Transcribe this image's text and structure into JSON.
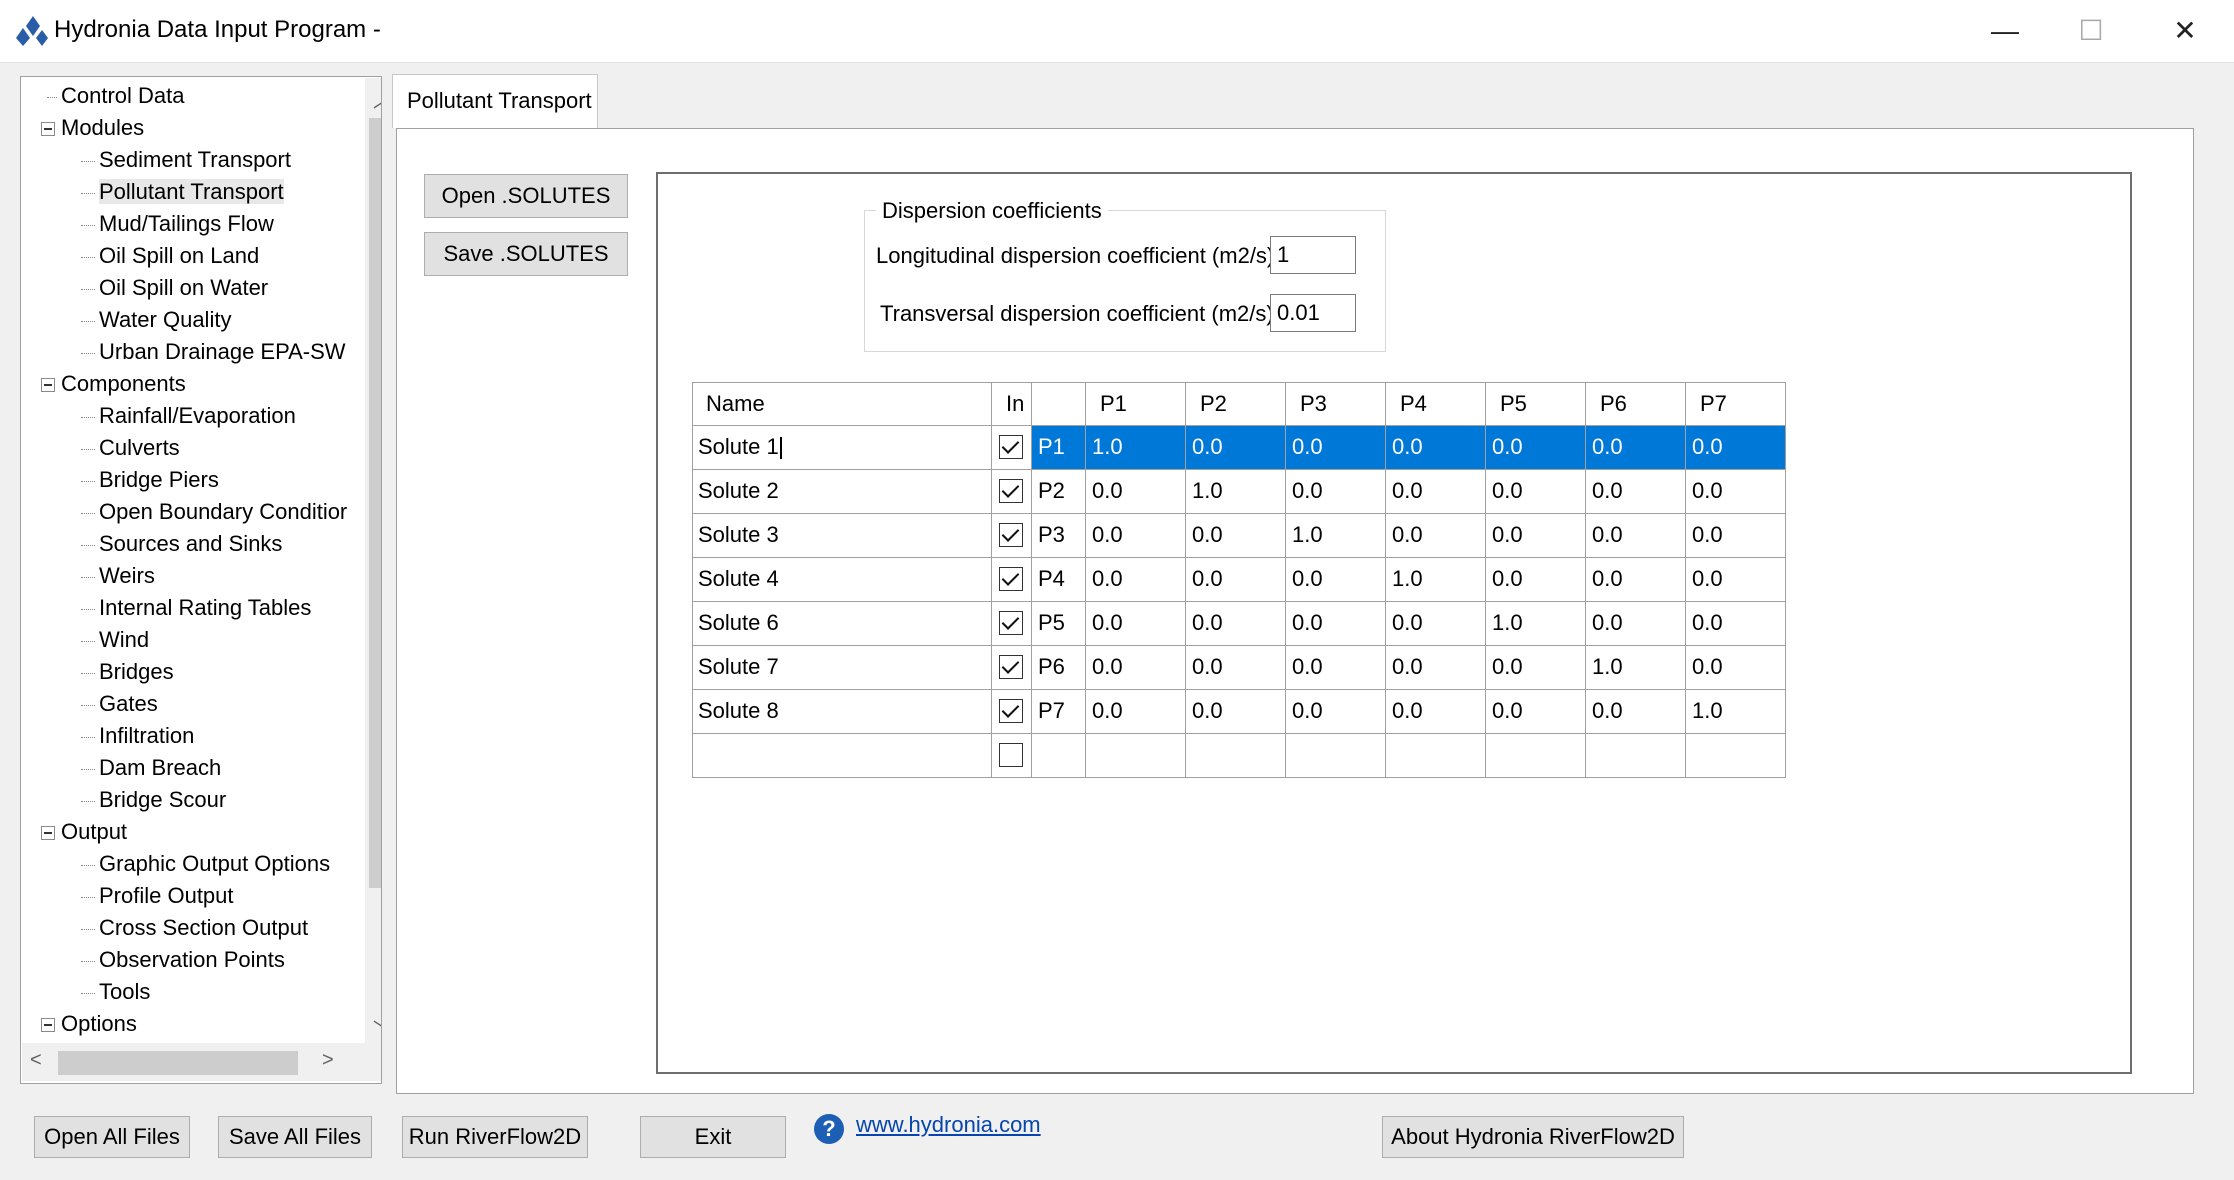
{
  "window": {
    "title": "Hydronia Data Input Program -",
    "minimize": "—",
    "maximize": "☐",
    "close": "✕"
  },
  "tree": {
    "items": [
      {
        "label": "Control Data",
        "level": 0
      },
      {
        "label": "Modules",
        "level": 0,
        "expander": true
      },
      {
        "label": "Sediment Transport",
        "level": 1
      },
      {
        "label": "Pollutant Transport",
        "level": 1,
        "selected": true
      },
      {
        "label": "Mud/Tailings Flow",
        "level": 1
      },
      {
        "label": "Oil Spill on Land",
        "level": 1
      },
      {
        "label": "Oil Spill on Water",
        "level": 1
      },
      {
        "label": "Water Quality",
        "level": 1
      },
      {
        "label": "Urban Drainage EPA-SW",
        "level": 1
      },
      {
        "label": "Components",
        "level": 0,
        "expander": true
      },
      {
        "label": "Rainfall/Evaporation",
        "level": 1
      },
      {
        "label": "Culverts",
        "level": 1
      },
      {
        "label": "Bridge Piers",
        "level": 1
      },
      {
        "label": "Open Boundary Conditior",
        "level": 1
      },
      {
        "label": "Sources and Sinks",
        "level": 1
      },
      {
        "label": "Weirs",
        "level": 1
      },
      {
        "label": "Internal Rating Tables",
        "level": 1
      },
      {
        "label": "Wind",
        "level": 1
      },
      {
        "label": "Bridges",
        "level": 1
      },
      {
        "label": "Gates",
        "level": 1
      },
      {
        "label": "Infiltration",
        "level": 1
      },
      {
        "label": "Dam Breach",
        "level": 1
      },
      {
        "label": "Bridge Scour",
        "level": 1
      },
      {
        "label": "Output",
        "level": 0,
        "expander": true
      },
      {
        "label": "Graphic Output Options",
        "level": 1
      },
      {
        "label": "Profile Output",
        "level": 1
      },
      {
        "label": "Cross Section Output",
        "level": 1
      },
      {
        "label": "Observation Points",
        "level": 1
      },
      {
        "label": "Tools",
        "level": 1
      },
      {
        "label": "Options",
        "level": 0,
        "expander": true
      }
    ]
  },
  "tab": {
    "label": "Pollutant Transport"
  },
  "buttons": {
    "open_solutes": "Open .SOLUTES",
    "save_solutes": "Save .SOLUTES"
  },
  "dispersion": {
    "group_title": "Dispersion coefficients",
    "longitudinal_label": "Longitudinal dispersion coefficient (m2/s)",
    "longitudinal_value": "1",
    "transversal_label": "Transversal dispersion coefficient (m2/s):",
    "transversal_value": "0.01"
  },
  "grid": {
    "headers": [
      "Name",
      "In",
      "",
      "P1",
      "P2",
      "P3",
      "P4",
      "P5",
      "P6",
      "P7"
    ],
    "rows": [
      {
        "name": "Solute 1",
        "in": true,
        "param": "P1",
        "values": [
          "1.0",
          "0.0",
          "0.0",
          "0.0",
          "0.0",
          "0.0",
          "0.0"
        ],
        "selected": true
      },
      {
        "name": "Solute 2",
        "in": true,
        "param": "P2",
        "values": [
          "0.0",
          "1.0",
          "0.0",
          "0.0",
          "0.0",
          "0.0",
          "0.0"
        ]
      },
      {
        "name": "Solute 3",
        "in": true,
        "param": "P3",
        "values": [
          "0.0",
          "0.0",
          "1.0",
          "0.0",
          "0.0",
          "0.0",
          "0.0"
        ]
      },
      {
        "name": "Solute 4",
        "in": true,
        "param": "P4",
        "values": [
          "0.0",
          "0.0",
          "0.0",
          "1.0",
          "0.0",
          "0.0",
          "0.0"
        ]
      },
      {
        "name": "Solute 6",
        "in": true,
        "param": "P5",
        "values": [
          "0.0",
          "0.0",
          "0.0",
          "0.0",
          "1.0",
          "0.0",
          "0.0"
        ]
      },
      {
        "name": "Solute 7",
        "in": true,
        "param": "P6",
        "values": [
          "0.0",
          "0.0",
          "0.0",
          "0.0",
          "0.0",
          "1.0",
          "0.0"
        ]
      },
      {
        "name": "Solute 8",
        "in": true,
        "param": "P7",
        "values": [
          "0.0",
          "0.0",
          "0.0",
          "0.0",
          "0.0",
          "0.0",
          "1.0"
        ]
      },
      {
        "name": "",
        "in": false,
        "param": "",
        "values": [
          "",
          "",
          "",
          "",
          "",
          "",
          ""
        ]
      }
    ]
  },
  "footer": {
    "open_all": "Open All Files",
    "save_all": "Save All Files",
    "run": "Run RiverFlow2D",
    "exit": "Exit",
    "help_glyph": "?",
    "link": "www.hydronia.com",
    "about": "About Hydronia RiverFlow2D"
  },
  "colors": {
    "selection": "#0078d7",
    "link": "#0645ad",
    "help_icon": "#1d5fb4"
  }
}
